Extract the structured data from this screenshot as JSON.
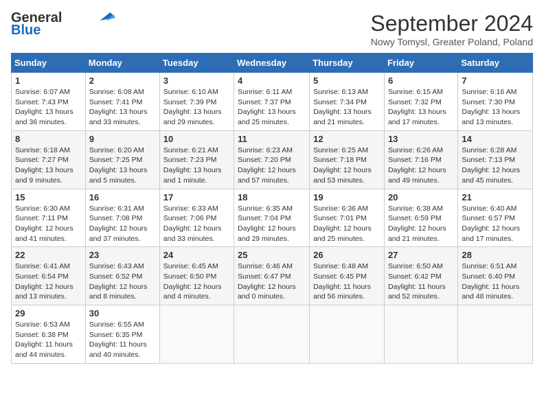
{
  "logo": {
    "line1": "General",
    "line2": "Blue"
  },
  "title": "September 2024",
  "subtitle": "Nowy Tomysl, Greater Poland, Poland",
  "days_header": [
    "Sunday",
    "Monday",
    "Tuesday",
    "Wednesday",
    "Thursday",
    "Friday",
    "Saturday"
  ],
  "weeks": [
    [
      {
        "day": "1",
        "info": "Sunrise: 6:07 AM\nSunset: 7:43 PM\nDaylight: 13 hours\nand 36 minutes."
      },
      {
        "day": "2",
        "info": "Sunrise: 6:08 AM\nSunset: 7:41 PM\nDaylight: 13 hours\nand 33 minutes."
      },
      {
        "day": "3",
        "info": "Sunrise: 6:10 AM\nSunset: 7:39 PM\nDaylight: 13 hours\nand 29 minutes."
      },
      {
        "day": "4",
        "info": "Sunrise: 6:11 AM\nSunset: 7:37 PM\nDaylight: 13 hours\nand 25 minutes."
      },
      {
        "day": "5",
        "info": "Sunrise: 6:13 AM\nSunset: 7:34 PM\nDaylight: 13 hours\nand 21 minutes."
      },
      {
        "day": "6",
        "info": "Sunrise: 6:15 AM\nSunset: 7:32 PM\nDaylight: 13 hours\nand 17 minutes."
      },
      {
        "day": "7",
        "info": "Sunrise: 6:16 AM\nSunset: 7:30 PM\nDaylight: 13 hours\nand 13 minutes."
      }
    ],
    [
      {
        "day": "8",
        "info": "Sunrise: 6:18 AM\nSunset: 7:27 PM\nDaylight: 13 hours\nand 9 minutes."
      },
      {
        "day": "9",
        "info": "Sunrise: 6:20 AM\nSunset: 7:25 PM\nDaylight: 13 hours\nand 5 minutes."
      },
      {
        "day": "10",
        "info": "Sunrise: 6:21 AM\nSunset: 7:23 PM\nDaylight: 13 hours\nand 1 minute."
      },
      {
        "day": "11",
        "info": "Sunrise: 6:23 AM\nSunset: 7:20 PM\nDaylight: 12 hours\nand 57 minutes."
      },
      {
        "day": "12",
        "info": "Sunrise: 6:25 AM\nSunset: 7:18 PM\nDaylight: 12 hours\nand 53 minutes."
      },
      {
        "day": "13",
        "info": "Sunrise: 6:26 AM\nSunset: 7:16 PM\nDaylight: 12 hours\nand 49 minutes."
      },
      {
        "day": "14",
        "info": "Sunrise: 6:28 AM\nSunset: 7:13 PM\nDaylight: 12 hours\nand 45 minutes."
      }
    ],
    [
      {
        "day": "15",
        "info": "Sunrise: 6:30 AM\nSunset: 7:11 PM\nDaylight: 12 hours\nand 41 minutes."
      },
      {
        "day": "16",
        "info": "Sunrise: 6:31 AM\nSunset: 7:08 PM\nDaylight: 12 hours\nand 37 minutes."
      },
      {
        "day": "17",
        "info": "Sunrise: 6:33 AM\nSunset: 7:06 PM\nDaylight: 12 hours\nand 33 minutes."
      },
      {
        "day": "18",
        "info": "Sunrise: 6:35 AM\nSunset: 7:04 PM\nDaylight: 12 hours\nand 29 minutes."
      },
      {
        "day": "19",
        "info": "Sunrise: 6:36 AM\nSunset: 7:01 PM\nDaylight: 12 hours\nand 25 minutes."
      },
      {
        "day": "20",
        "info": "Sunrise: 6:38 AM\nSunset: 6:59 PM\nDaylight: 12 hours\nand 21 minutes."
      },
      {
        "day": "21",
        "info": "Sunrise: 6:40 AM\nSunset: 6:57 PM\nDaylight: 12 hours\nand 17 minutes."
      }
    ],
    [
      {
        "day": "22",
        "info": "Sunrise: 6:41 AM\nSunset: 6:54 PM\nDaylight: 12 hours\nand 13 minutes."
      },
      {
        "day": "23",
        "info": "Sunrise: 6:43 AM\nSunset: 6:52 PM\nDaylight: 12 hours\nand 8 minutes."
      },
      {
        "day": "24",
        "info": "Sunrise: 6:45 AM\nSunset: 6:50 PM\nDaylight: 12 hours\nand 4 minutes."
      },
      {
        "day": "25",
        "info": "Sunrise: 6:46 AM\nSunset: 6:47 PM\nDaylight: 12 hours\nand 0 minutes."
      },
      {
        "day": "26",
        "info": "Sunrise: 6:48 AM\nSunset: 6:45 PM\nDaylight: 11 hours\nand 56 minutes."
      },
      {
        "day": "27",
        "info": "Sunrise: 6:50 AM\nSunset: 6:42 PM\nDaylight: 11 hours\nand 52 minutes."
      },
      {
        "day": "28",
        "info": "Sunrise: 6:51 AM\nSunset: 6:40 PM\nDaylight: 11 hours\nand 48 minutes."
      }
    ],
    [
      {
        "day": "29",
        "info": "Sunrise: 6:53 AM\nSunset: 6:38 PM\nDaylight: 11 hours\nand 44 minutes."
      },
      {
        "day": "30",
        "info": "Sunrise: 6:55 AM\nSunset: 6:35 PM\nDaylight: 11 hours\nand 40 minutes."
      },
      {
        "day": "",
        "info": ""
      },
      {
        "day": "",
        "info": ""
      },
      {
        "day": "",
        "info": ""
      },
      {
        "day": "",
        "info": ""
      },
      {
        "day": "",
        "info": ""
      }
    ]
  ]
}
